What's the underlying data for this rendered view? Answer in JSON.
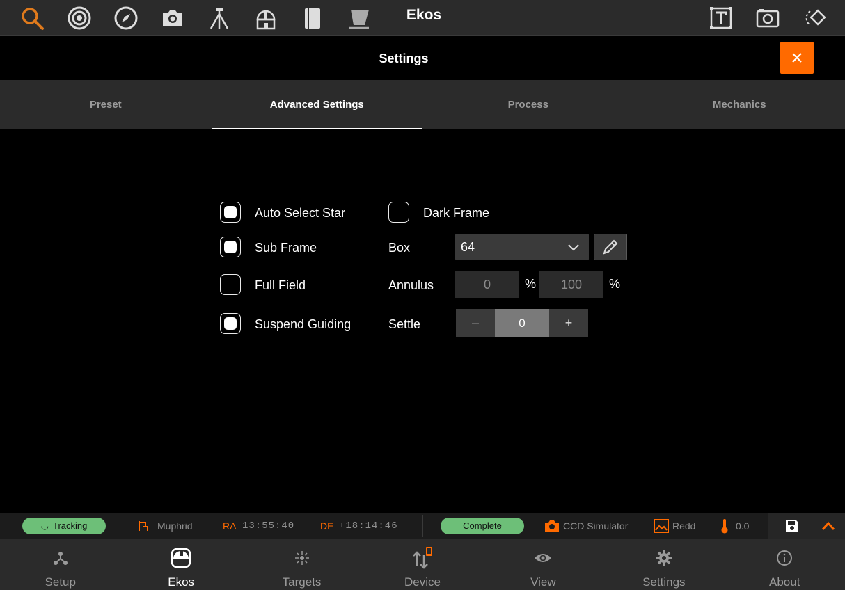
{
  "toolbar": {
    "title": "Ekos",
    "icons": [
      "search-icon",
      "target-icon",
      "compass-icon",
      "camera-icon",
      "tripod-icon",
      "observatory-icon",
      "book-icon",
      "filter-icon",
      "text-frame-icon",
      "screenshot-icon",
      "rotate-icon"
    ],
    "accent": "#ff6a00"
  },
  "header": {
    "title": "Settings",
    "close_icon": "close-icon"
  },
  "tabs": [
    {
      "label": "Preset"
    },
    {
      "label": "Advanced Settings"
    },
    {
      "label": "Process"
    },
    {
      "label": "Mechanics"
    }
  ],
  "active_tab": "Advanced Settings",
  "options": {
    "auto_select_star": {
      "label": "Auto Select Star",
      "checked": true
    },
    "sub_frame": {
      "label": "Sub Frame",
      "checked": true
    },
    "full_field": {
      "label": "Full Field",
      "checked": false
    },
    "suspend_guiding": {
      "label": "Suspend Guiding",
      "checked": true
    },
    "dark_frame": {
      "label": "Dark Frame",
      "checked": false
    }
  },
  "box": {
    "label": "Box",
    "value": "64"
  },
  "annulus": {
    "label": "Annulus",
    "inner": "0",
    "outer": "100",
    "unit": "%"
  },
  "settle": {
    "label": "Settle",
    "value": "0",
    "minus": "–",
    "plus": "+"
  },
  "status": {
    "tracking": "Tracking",
    "target": "Muphrid",
    "ra_label": "RA",
    "ra_value": "13:55:40",
    "de_label": "DE",
    "de_value": "+18:14:46",
    "capture": "Complete",
    "camera": "CCD Simulator",
    "image": "Redd",
    "temperature": "0.0",
    "pill_color": "#6dbf78"
  },
  "nav": [
    {
      "label": "Setup",
      "icon": "setup-icon"
    },
    {
      "label": "Ekos",
      "icon": "ekos-icon"
    },
    {
      "label": "Targets",
      "icon": "targets-icon"
    },
    {
      "label": "Device",
      "icon": "device-icon"
    },
    {
      "label": "View",
      "icon": "eye-icon"
    },
    {
      "label": "Settings",
      "icon": "gear-icon"
    },
    {
      "label": "About",
      "icon": "info-icon"
    }
  ],
  "active_nav": "Ekos"
}
